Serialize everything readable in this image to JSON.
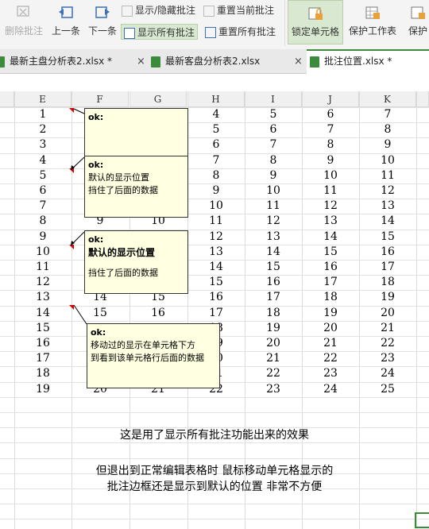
{
  "ribbon": {
    "delete_comment": "删除批注",
    "prev": "上一条",
    "next": "下一条",
    "show_hide_comment": "显示/隐藏批注",
    "reset_current_comment": "重置当前批注",
    "show_all_comments": "显示所有批注",
    "reset_all_comments": "重置所有批注",
    "lock_cell": "锁定单元格",
    "protect_sheet": "保护工作表",
    "protect_more": "保护"
  },
  "tabs": [
    {
      "label": "最新主盘分析表2.xlsx *"
    },
    {
      "label": "最新客盘分析表2.xlsx"
    },
    {
      "label": "批注位置.xlsx *"
    }
  ],
  "close_glyph": "×",
  "columns": [
    "E",
    "F",
    "G",
    "H",
    "I",
    "J",
    "K"
  ],
  "rows": [
    [
      "1",
      "",
      "",
      "4",
      "5",
      "6",
      "7"
    ],
    [
      "2",
      "",
      "",
      "5",
      "6",
      "7",
      "8"
    ],
    [
      "3",
      "",
      "",
      "6",
      "7",
      "8",
      "9"
    ],
    [
      "4",
      "",
      "",
      "7",
      "8",
      "9",
      "10"
    ],
    [
      "5",
      "",
      "",
      "8",
      "9",
      "10",
      "11"
    ],
    [
      "6",
      "",
      "",
      "9",
      "10",
      "11",
      "12"
    ],
    [
      "7",
      "",
      "",
      "10",
      "11",
      "12",
      "13"
    ],
    [
      "8",
      "9",
      "10",
      "11",
      "12",
      "13",
      "14"
    ],
    [
      "9",
      "",
      "",
      "12",
      "13",
      "14",
      "15"
    ],
    [
      "10",
      "",
      "",
      "13",
      "14",
      "15",
      "16"
    ],
    [
      "11",
      "",
      "",
      "14",
      "15",
      "16",
      "17"
    ],
    [
      "12",
      "",
      "",
      "15",
      "16",
      "17",
      "18"
    ],
    [
      "13",
      "14",
      "15",
      "16",
      "17",
      "18",
      "19"
    ],
    [
      "14",
      "15",
      "16",
      "17",
      "18",
      "19",
      "20"
    ],
    [
      "15",
      "",
      "",
      "18",
      "19",
      "20",
      "21"
    ],
    [
      "16",
      "",
      "",
      "19",
      "20",
      "21",
      "22"
    ],
    [
      "17",
      "",
      "",
      "20",
      "21",
      "22",
      "23"
    ],
    [
      "18",
      "",
      "",
      "21",
      "22",
      "23",
      "24"
    ],
    [
      "19",
      "20",
      "21",
      "22",
      "23",
      "24",
      "25"
    ]
  ],
  "comments": [
    {
      "author": "ok:",
      "text": ""
    },
    {
      "author": "ok:",
      "line1": "默认的显示位置",
      "line2": "挡住了后面的数据"
    },
    {
      "author": "ok:",
      "line1": "默认的显示位置",
      "line2": "挡住了后面的数据"
    },
    {
      "author": "ok:",
      "line1": "移动过的显示在单元格下方",
      "line2": "到看到该单元格行后面的数据"
    }
  ],
  "messages": {
    "line1": "这是用了显示所有批注功能出来的效果",
    "line2": "但退出到正常编辑表格时   鼠标移动单元格显示的",
    "line3": "批注边框还是显示到默认的位置 非常不方便"
  }
}
